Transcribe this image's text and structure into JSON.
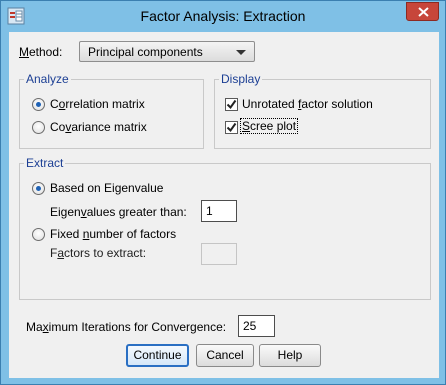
{
  "window": {
    "title": "Factor Analysis: Extraction",
    "app_icon": "spss-icon",
    "close_icon": "close-icon"
  },
  "method": {
    "label": "Method:",
    "selected": "Principal components"
  },
  "analyze": {
    "legend": "Analyze",
    "options": [
      {
        "label": "Correlation matrix",
        "checked": true
      },
      {
        "label": "Covariance matrix",
        "checked": false
      }
    ]
  },
  "display": {
    "legend": "Display",
    "options": [
      {
        "label": "Unrotated factor solution",
        "checked": true
      },
      {
        "label": "Scree plot",
        "checked": true
      }
    ]
  },
  "extract": {
    "legend": "Extract",
    "eigen_radio": "Based on Eigenvalue",
    "eigen_label": "Eigenvalues greater than:",
    "eigen_value": "1",
    "fixed_radio": "Fixed number of factors",
    "factors_label": "Factors to extract:",
    "factors_value": ""
  },
  "iterations": {
    "label": "Maximum Iterations for Convergence:",
    "value": "25"
  },
  "buttons": {
    "continue": "Continue",
    "cancel": "Cancel",
    "help": "Help"
  },
  "colors": {
    "titlebar": "#7fc0e6",
    "legend_text": "#1c3f94",
    "close_button": "#c7463a",
    "default_button_border": "#2a6fc3"
  }
}
